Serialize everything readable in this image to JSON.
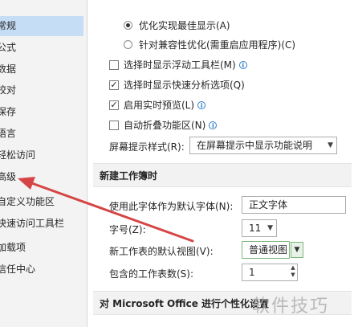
{
  "sidebar": {
    "items": [
      {
        "label": "常规",
        "selected": true
      },
      {
        "label": "公式",
        "selected": false
      },
      {
        "label": "数据",
        "selected": false
      },
      {
        "label": "校对",
        "selected": false
      },
      {
        "label": "保存",
        "selected": false
      },
      {
        "label": "语言",
        "selected": false
      },
      {
        "label": "轻松访问",
        "selected": false
      },
      {
        "label": "高级",
        "selected": false
      },
      {
        "label": "自定义功能区",
        "selected": false
      },
      {
        "label": "快速访问工具栏",
        "selected": false
      },
      {
        "label": "加载项",
        "selected": false
      },
      {
        "label": "信任中心",
        "selected": false
      }
    ]
  },
  "ui_options": {
    "radio_best_display": "优化实现最佳显示(A)",
    "radio_compat": "针对兼容性优化(需重启应用程序)(C)",
    "check_mini_toolbar": "选择时显示浮动工具栏(M)",
    "check_quick_analysis": "选择时显示快速分析选项(Q)",
    "check_live_preview": "启用实时预览(L)",
    "check_collapse_ribbon": "自动折叠功能区(N)",
    "screentip_label": "屏幕提示样式(R):",
    "screentip_value": "在屏幕提示中显示功能说明"
  },
  "new_workbook": {
    "header": "新建工作簿时",
    "font_label": "使用此字体作为默认字体(N):",
    "font_value": "正文字体",
    "size_label": "字号(Z):",
    "size_value": "11",
    "view_label": "新工作表的默认视图(V):",
    "view_value": "普通视图",
    "sheets_label": "包含的工作表数(S):",
    "sheets_value": "1"
  },
  "personalize": {
    "header": "对 Microsoft Office 进行个性化设置"
  },
  "watermark": "软件技巧",
  "colors": {
    "selected_bg": "#c5ddf5",
    "arrow": "#d64545",
    "info": "#2f7cc9"
  }
}
